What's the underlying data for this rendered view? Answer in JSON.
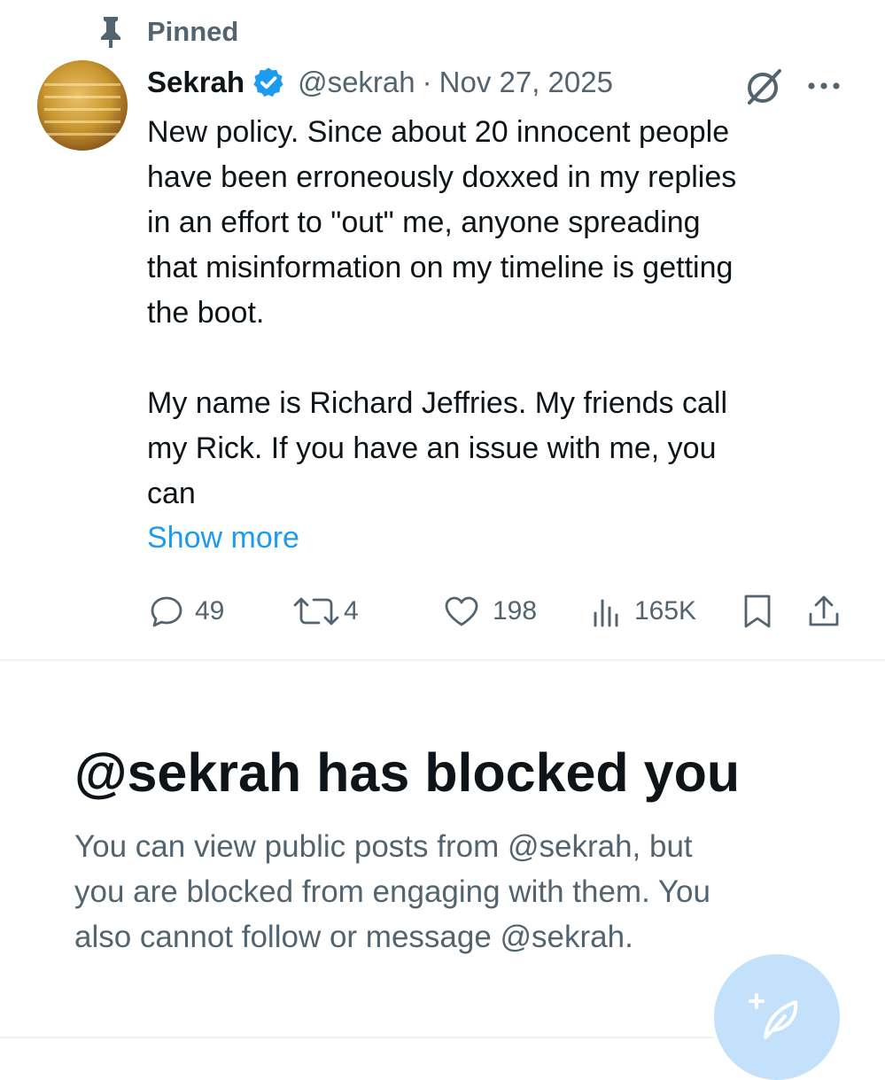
{
  "pinned": {
    "label": "Pinned",
    "icon": "pin-icon"
  },
  "tweet": {
    "author_name": "Sekrah",
    "verified_icon": "verified-badge-icon",
    "handle": "@sekrah",
    "separator": "·",
    "date": "Nov 27, 2025",
    "body_lines_p1": [
      "New policy. Since about 20 innocent people",
      "have been erroneously doxxed in my replies",
      "in an effort to \"out\" me, anyone spreading",
      "that misinformation on my timeline is getting",
      "the boot."
    ],
    "body_lines_p2": [
      "My name is Richard Jeffries. My friends call",
      "my Rick. If you have an issue with me, you",
      "can"
    ],
    "show_more": "Show more",
    "actions": {
      "replies": "49",
      "reposts": "4",
      "likes": "198",
      "views": "165K"
    }
  },
  "blocked": {
    "title": "@sekrah has blocked you",
    "lines": [
      "You can view public posts from @sekrah, but",
      "you are blocked from engaging with them. You",
      "also cannot follow or message @sekrah."
    ]
  },
  "colors": {
    "text_primary": "#0f1419",
    "text_secondary": "#536471",
    "accent": "#1d9bf0",
    "fab_background": "#c3e1fb",
    "divider": "#eff3f4"
  }
}
